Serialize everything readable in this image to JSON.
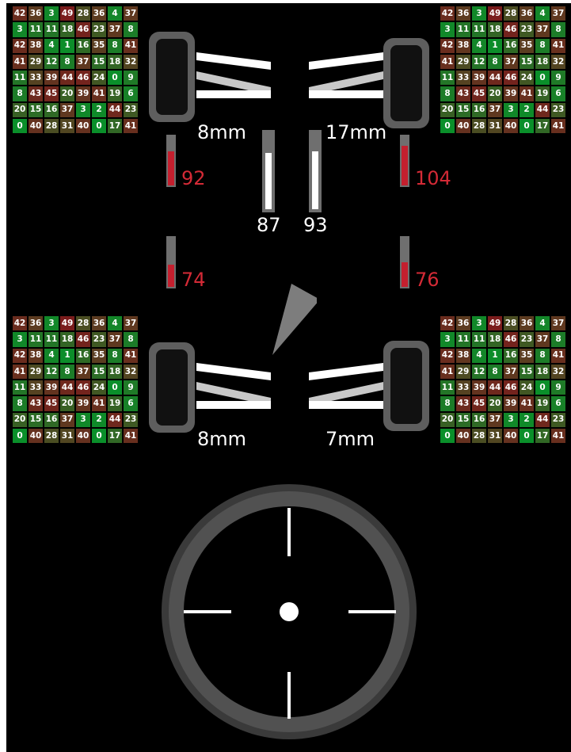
{
  "colors": {
    "background": "#000000",
    "tire_body": "#111111",
    "tire_frame": "#5e5e5e",
    "camber_line": "#ffffff",
    "camber_line_mid": "#c8c8c8",
    "temp_red": "#d42a36",
    "bar_track": "#6f6f6f",
    "bar_fill_red": "#c41f2e",
    "bar_fill_white": "#ffffff",
    "gauge_ring": "#4d4d4d",
    "gauge_face": "#000000",
    "heat_scale": {
      "cold": "#0a8f2a",
      "warm": "#7a1c1c"
    }
  },
  "heat_grid_values": [
    [
      42,
      36,
      3,
      49,
      28,
      36,
      4,
      37
    ],
    [
      3,
      11,
      11,
      18,
      46,
      23,
      37,
      8
    ],
    [
      42,
      38,
      4,
      1,
      16,
      35,
      8,
      41
    ],
    [
      41,
      29,
      12,
      8,
      37,
      15,
      18,
      32
    ],
    [
      11,
      33,
      39,
      44,
      46,
      24,
      0,
      9
    ],
    [
      8,
      43,
      45,
      20,
      39,
      41,
      19,
      6
    ],
    [
      20,
      15,
      16,
      37,
      3,
      2,
      44,
      23
    ],
    [
      0,
      40,
      28,
      31,
      40,
      0,
      17,
      41
    ]
  ],
  "wheels": {
    "front_left": {
      "wear_label": "8mm",
      "temperature": "92",
      "temp_level": 0.7
    },
    "front_right": {
      "wear_label": "17mm",
      "temperature": "104",
      "temp_level": 0.8
    },
    "rear_left": {
      "wear_label": "8mm",
      "temperature": "74",
      "temp_level": 0.45
    },
    "rear_right": {
      "wear_label": "7mm",
      "temperature": "76",
      "temp_level": 0.5
    }
  },
  "pedals": {
    "left": {
      "value": "87",
      "level": 0.9
    },
    "right": {
      "value": "93",
      "level": 0.93
    }
  },
  "direction_icon": "triangle-pointer-icon",
  "gauge_icon": "crosshair-icon"
}
